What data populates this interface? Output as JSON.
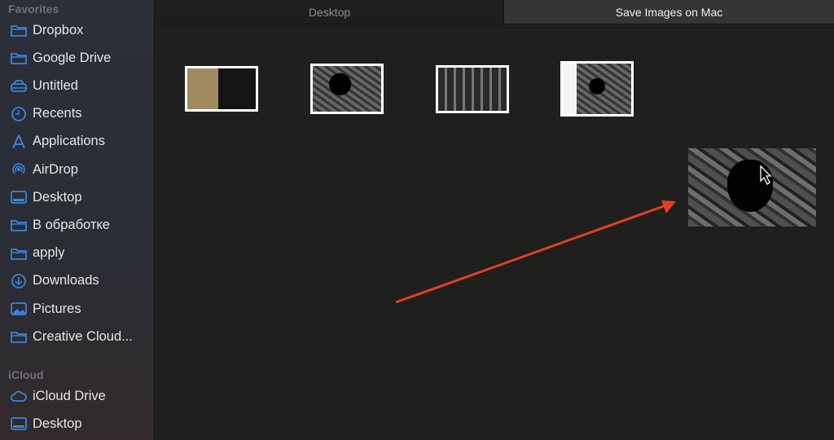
{
  "sidebar": {
    "favorites_header": "Favorites",
    "favorites": [
      {
        "label": "Dropbox",
        "icon": "folder-icon"
      },
      {
        "label": "Google Drive",
        "icon": "folder-icon"
      },
      {
        "label": "Untitled",
        "icon": "drive-icon"
      },
      {
        "label": "Recents",
        "icon": "clock-icon"
      },
      {
        "label": "Applications",
        "icon": "applications-icon"
      },
      {
        "label": "AirDrop",
        "icon": "airdrop-icon"
      },
      {
        "label": "Desktop",
        "icon": "desktop-icon"
      },
      {
        "label": "В обработке",
        "icon": "folder-icon"
      },
      {
        "label": "apply",
        "icon": "folder-icon"
      },
      {
        "label": "Downloads",
        "icon": "downloads-icon"
      },
      {
        "label": "Pictures",
        "icon": "pictures-icon"
      },
      {
        "label": "Creative Cloud...",
        "icon": "folder-icon"
      }
    ],
    "icloud_header": "iCloud",
    "icloud": [
      {
        "label": "iCloud Drive",
        "icon": "cloud-icon"
      },
      {
        "label": "Desktop",
        "icon": "desktop-icon"
      }
    ]
  },
  "tabs": [
    {
      "label": "Desktop",
      "active": false
    },
    {
      "label": "Save Images on Mac",
      "active": true
    }
  ],
  "colors": {
    "accent": "#3b82e0",
    "arrow": "#e0401f"
  }
}
